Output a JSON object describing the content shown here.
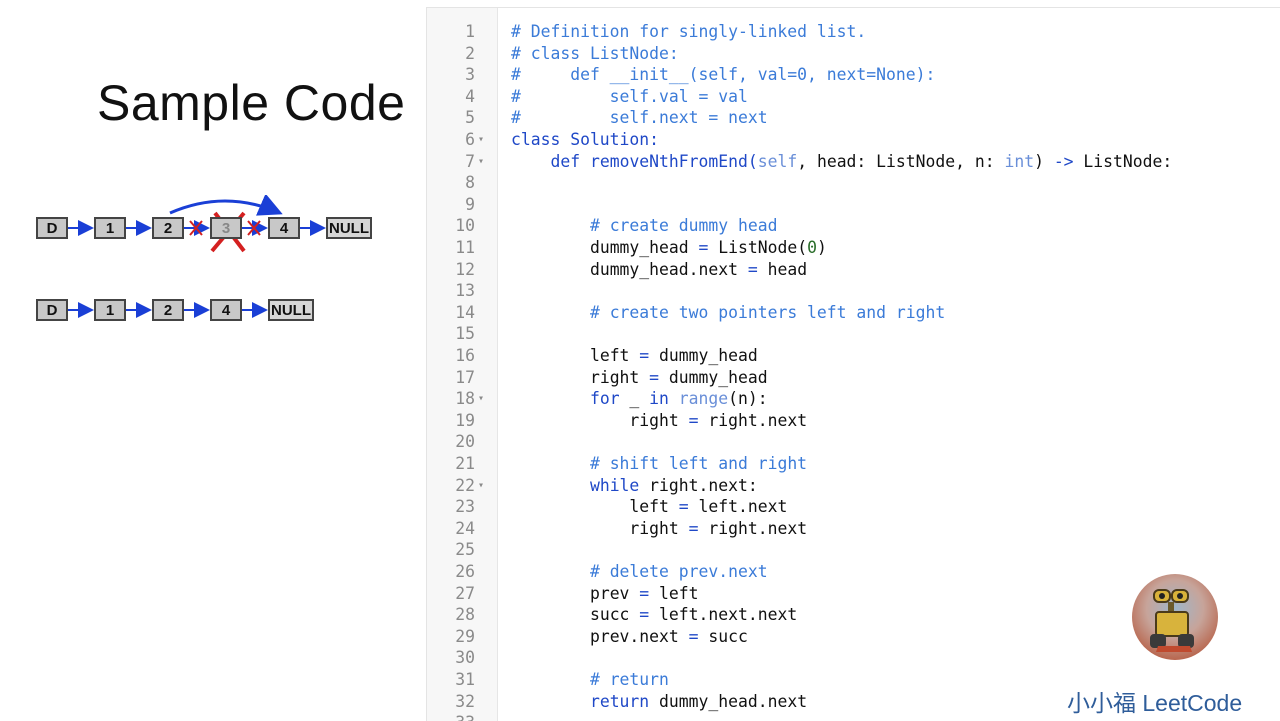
{
  "slide": {
    "title": "Sample Code",
    "brand": "小小福 LeetCode"
  },
  "diagram": {
    "before": [
      "D",
      "1",
      "2",
      "3",
      "4",
      "NULL"
    ],
    "after": [
      "D",
      "1",
      "2",
      "4",
      "NULL"
    ],
    "deleted_node": "3",
    "colors": {
      "arrow": "#1a3fd6",
      "cross": "#d42020",
      "node_fill": "#c8c8c8"
    }
  },
  "editor": {
    "lines": [
      {
        "n": "1",
        "fold": false,
        "indent": 0,
        "tokens": [
          {
            "t": "# Definition for singly-linked list.",
            "c": "comment"
          }
        ]
      },
      {
        "n": "2",
        "fold": false,
        "indent": 0,
        "tokens": [
          {
            "t": "# class ListNode:",
            "c": "comment"
          }
        ]
      },
      {
        "n": "3",
        "fold": false,
        "indent": 0,
        "tokens": [
          {
            "t": "#     def __init__(self, val=0, next=None):",
            "c": "comment"
          }
        ]
      },
      {
        "n": "4",
        "fold": false,
        "indent": 0,
        "tokens": [
          {
            "t": "#         self.val = val",
            "c": "comment"
          }
        ]
      },
      {
        "n": "5",
        "fold": false,
        "indent": 0,
        "tokens": [
          {
            "t": "#         self.next = next",
            "c": "comment"
          }
        ]
      },
      {
        "n": "6",
        "fold": true,
        "indent": 0,
        "tokens": [
          {
            "t": "class Solution:",
            "c": "kw"
          }
        ]
      },
      {
        "n": "7",
        "fold": true,
        "indent": 4,
        "tokens": [
          {
            "t": "def ",
            "c": "kw"
          },
          {
            "t": "removeNthFromEnd(",
            "c": "kw"
          },
          {
            "t": "self",
            "c": "builtin"
          },
          {
            "t": ", head: ListNode, n: ",
            "c": ""
          },
          {
            "t": "int",
            "c": "builtin"
          },
          {
            "t": ") ",
            "c": ""
          },
          {
            "t": "->",
            "c": "op"
          },
          {
            "t": " ListNode:",
            "c": ""
          }
        ]
      },
      {
        "n": "8",
        "fold": false,
        "indent": 0,
        "tokens": []
      },
      {
        "n": "9",
        "fold": false,
        "indent": 0,
        "tokens": []
      },
      {
        "n": "10",
        "fold": false,
        "indent": 8,
        "tokens": [
          {
            "t": "# create dummy head",
            "c": "comment"
          }
        ]
      },
      {
        "n": "11",
        "fold": false,
        "indent": 8,
        "tokens": [
          {
            "t": "dummy_head ",
            "c": ""
          },
          {
            "t": "=",
            "c": "op"
          },
          {
            "t": " ListNode(",
            "c": ""
          },
          {
            "t": "0",
            "c": "num"
          },
          {
            "t": ")",
            "c": ""
          }
        ]
      },
      {
        "n": "12",
        "fold": false,
        "indent": 8,
        "tokens": [
          {
            "t": "dummy_head.next ",
            "c": ""
          },
          {
            "t": "=",
            "c": "op"
          },
          {
            "t": " head",
            "c": ""
          }
        ]
      },
      {
        "n": "13",
        "fold": false,
        "indent": 0,
        "tokens": []
      },
      {
        "n": "14",
        "fold": false,
        "indent": 8,
        "tokens": [
          {
            "t": "# create two pointers left and right",
            "c": "comment"
          }
        ]
      },
      {
        "n": "15",
        "fold": false,
        "indent": 0,
        "tokens": []
      },
      {
        "n": "16",
        "fold": false,
        "indent": 8,
        "tokens": [
          {
            "t": "left ",
            "c": ""
          },
          {
            "t": "=",
            "c": "op"
          },
          {
            "t": " dummy_head",
            "c": ""
          }
        ]
      },
      {
        "n": "17",
        "fold": false,
        "indent": 8,
        "tokens": [
          {
            "t": "right ",
            "c": ""
          },
          {
            "t": "=",
            "c": "op"
          },
          {
            "t": " dummy_head",
            "c": ""
          }
        ]
      },
      {
        "n": "18",
        "fold": true,
        "indent": 8,
        "tokens": [
          {
            "t": "for",
            "c": "kw"
          },
          {
            "t": " _ ",
            "c": ""
          },
          {
            "t": "in",
            "c": "kw"
          },
          {
            "t": " ",
            "c": ""
          },
          {
            "t": "range",
            "c": "builtin"
          },
          {
            "t": "(n):",
            "c": ""
          }
        ]
      },
      {
        "n": "19",
        "fold": false,
        "indent": 12,
        "tokens": [
          {
            "t": "right ",
            "c": ""
          },
          {
            "t": "=",
            "c": "op"
          },
          {
            "t": " right.next",
            "c": ""
          }
        ]
      },
      {
        "n": "20",
        "fold": false,
        "indent": 0,
        "tokens": []
      },
      {
        "n": "21",
        "fold": false,
        "indent": 8,
        "tokens": [
          {
            "t": "# shift left and right",
            "c": "comment"
          }
        ]
      },
      {
        "n": "22",
        "fold": true,
        "indent": 8,
        "tokens": [
          {
            "t": "while",
            "c": "kw"
          },
          {
            "t": " right.next:",
            "c": ""
          }
        ]
      },
      {
        "n": "23",
        "fold": false,
        "indent": 12,
        "tokens": [
          {
            "t": "left ",
            "c": ""
          },
          {
            "t": "=",
            "c": "op"
          },
          {
            "t": " left.next",
            "c": ""
          }
        ]
      },
      {
        "n": "24",
        "fold": false,
        "indent": 12,
        "tokens": [
          {
            "t": "right ",
            "c": ""
          },
          {
            "t": "=",
            "c": "op"
          },
          {
            "t": " right.next",
            "c": ""
          }
        ]
      },
      {
        "n": "25",
        "fold": false,
        "indent": 0,
        "tokens": []
      },
      {
        "n": "26",
        "fold": false,
        "indent": 8,
        "tokens": [
          {
            "t": "# delete prev.next",
            "c": "comment"
          }
        ]
      },
      {
        "n": "27",
        "fold": false,
        "indent": 8,
        "tokens": [
          {
            "t": "prev ",
            "c": ""
          },
          {
            "t": "=",
            "c": "op"
          },
          {
            "t": " left",
            "c": ""
          }
        ]
      },
      {
        "n": "28",
        "fold": false,
        "indent": 8,
        "tokens": [
          {
            "t": "succ ",
            "c": ""
          },
          {
            "t": "=",
            "c": "op"
          },
          {
            "t": " left.next.next",
            "c": ""
          }
        ]
      },
      {
        "n": "29",
        "fold": false,
        "indent": 8,
        "tokens": [
          {
            "t": "prev.next ",
            "c": ""
          },
          {
            "t": "=",
            "c": "op"
          },
          {
            "t": " succ",
            "c": ""
          }
        ]
      },
      {
        "n": "30",
        "fold": false,
        "indent": 0,
        "tokens": []
      },
      {
        "n": "31",
        "fold": false,
        "indent": 8,
        "tokens": [
          {
            "t": "# return",
            "c": "comment"
          }
        ]
      },
      {
        "n": "32",
        "fold": false,
        "indent": 8,
        "tokens": [
          {
            "t": "return",
            "c": "kw"
          },
          {
            "t": " dummy_head.next",
            "c": ""
          }
        ]
      },
      {
        "n": "33",
        "fold": false,
        "indent": 0,
        "tokens": []
      }
    ]
  },
  "avatar": {
    "icon": "robot-avatar-icon"
  }
}
